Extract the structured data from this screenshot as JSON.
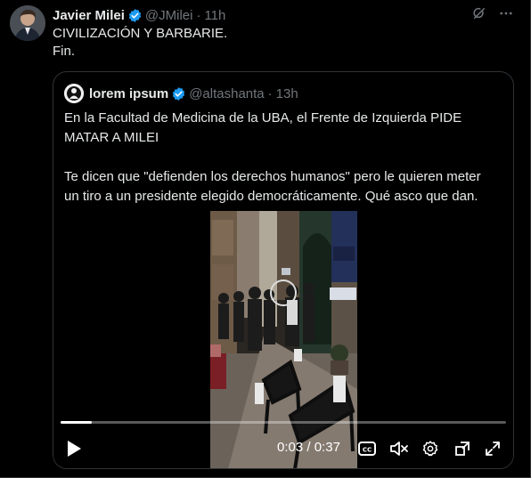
{
  "tweet": {
    "author_name": "Javier Milei",
    "handle": "@JMilei",
    "separator": "·",
    "time": "11h",
    "text": "CIVILIZACIÓN Y BARBARIE.\nFin."
  },
  "quoted": {
    "author_name": "lorem ipsum",
    "handle": "@altashanta",
    "separator": "·",
    "time": "13h",
    "text": "En la Facultad de Medicina de la UBA, el Frente de Izquierda PIDE\nMATAR A MILEI\n\nTe dicen que \"defienden los derechos humanos\" pero le quieren meter\nun tiro a un presidente elegido democráticamente. Qué asco que dan."
  },
  "video": {
    "current_time": "0:03",
    "time_separator": "/",
    "duration": "0:37",
    "progress_fraction": 0.07
  },
  "icons": {
    "header": [
      "grok-icon",
      "more-icon"
    ],
    "controls": [
      "play-icon",
      "captions-icon",
      "mute-icon",
      "settings-icon",
      "pip-icon",
      "fullscreen-icon"
    ]
  },
  "colors": {
    "background": "#000000",
    "text": "#e7e9ea",
    "secondary_text": "#71767b",
    "verified_blue": "#1d9bf0",
    "border": "#2f3336"
  }
}
